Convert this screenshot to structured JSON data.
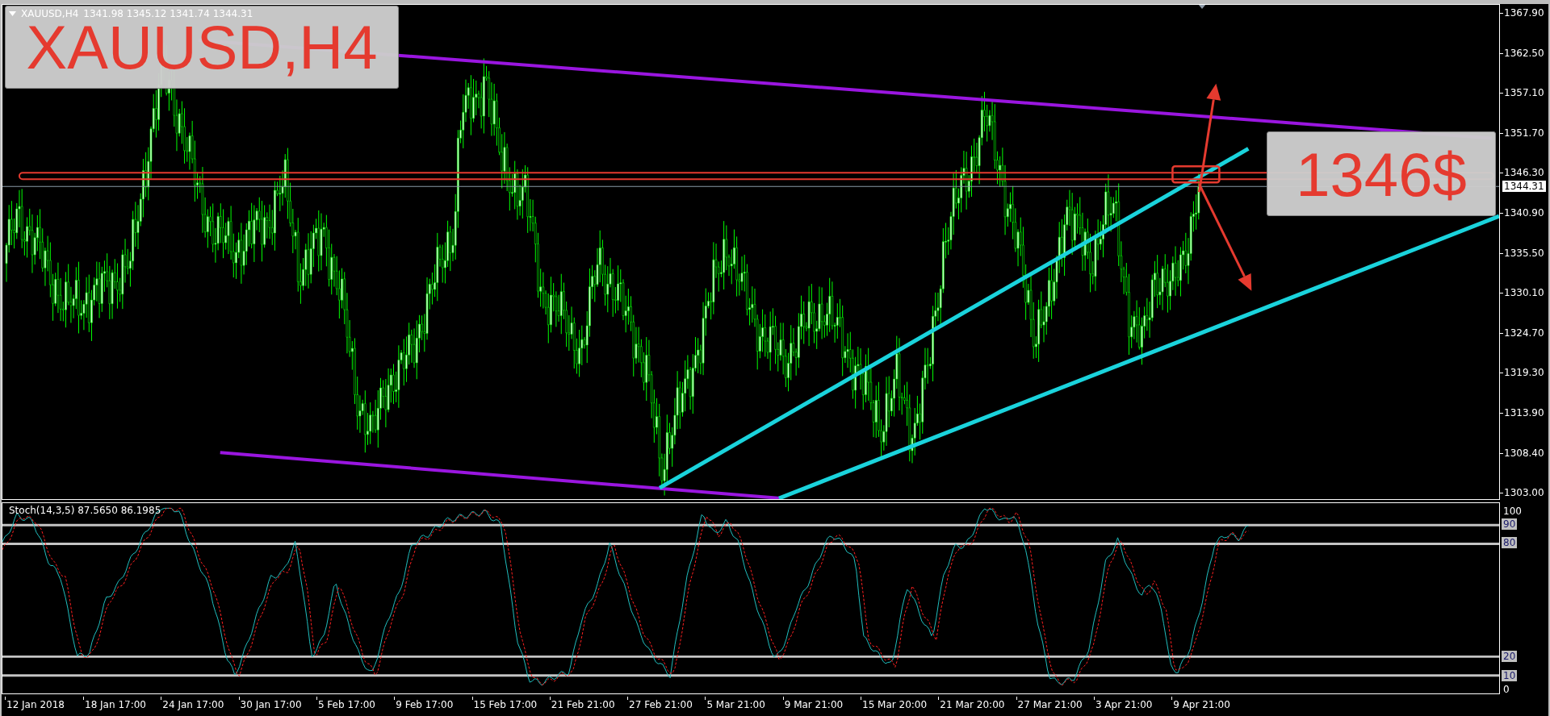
{
  "chart": {
    "header": {
      "symbol": "XAUUSD,H4",
      "ohlc": "1341.98 1345.12 1341.74 1344.31"
    },
    "symbol_label": "XAUUSD,H4",
    "price_label": "1346$",
    "price_axis": [
      "1367.90",
      "1362.50",
      "1357.10",
      "1351.70",
      "1346.30",
      "1340.90",
      "1335.50",
      "1330.10",
      "1324.70",
      "1319.30",
      "1313.90",
      "1308.40",
      "1303.00"
    ],
    "current_price": "1344.31"
  },
  "indicator": {
    "label": "Stoch(14,3,5) 87.5650 86.1985",
    "scale": [
      {
        "text": "100",
        "kind": "bound"
      },
      {
        "text": "90",
        "kind": "level"
      },
      {
        "text": "80",
        "kind": "level"
      },
      {
        "text": "20",
        "kind": "level"
      },
      {
        "text": "10",
        "kind": "level"
      },
      {
        "text": "0",
        "kind": "bound"
      }
    ]
  },
  "time_axis": [
    "12 Jan 2018",
    "18 Jan 17:00",
    "24 Jan 17:00",
    "30 Jan 17:00",
    "5 Feb 17:00",
    "9 Feb 17:00",
    "15 Feb 17:00",
    "21 Feb 21:00",
    "27 Feb 21:00",
    "5 Mar 21:00",
    "9 Mar 21:00",
    "15 Mar 20:00",
    "21 Mar 20:00",
    "27 Mar 21:00",
    "3 Apr 21:00",
    "9 Apr 21:00"
  ]
}
